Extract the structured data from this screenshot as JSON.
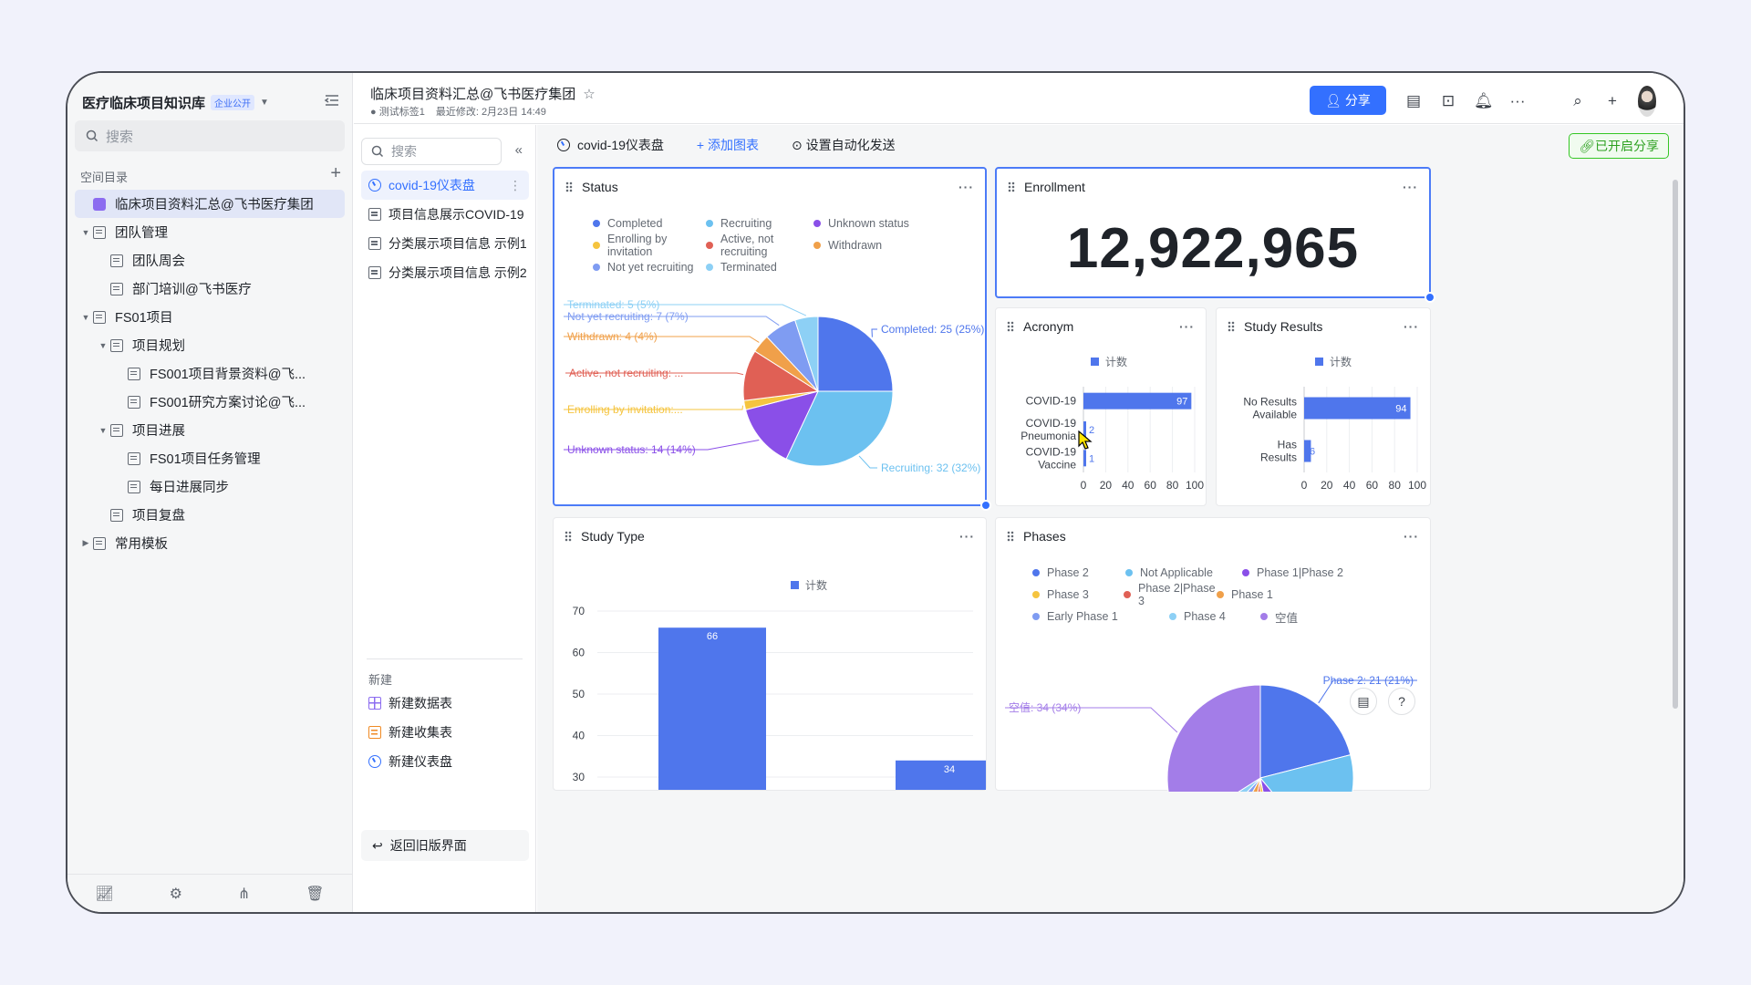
{
  "sidebar": {
    "workspace_title": "医疗临床项目知识库",
    "workspace_badge": "企业公开",
    "search_placeholder": "搜索",
    "section_label": "空间目录",
    "tree": [
      {
        "label": "临床项目资料汇总@飞书医疗集团",
        "level": 0,
        "type": "base",
        "active": true,
        "toggle": ""
      },
      {
        "label": "团队管理",
        "level": 0,
        "type": "doc",
        "toggle": "▼"
      },
      {
        "label": "团队周会",
        "level": 1,
        "type": "doc",
        "toggle": ""
      },
      {
        "label": "部门培训@飞书医疗",
        "level": 1,
        "type": "doc",
        "toggle": ""
      },
      {
        "label": "FS01项目",
        "level": 0,
        "type": "doc",
        "toggle": "▼"
      },
      {
        "label": "项目规划",
        "level": 1,
        "type": "doc",
        "toggle": "▼"
      },
      {
        "label": "FS001项目背景资料@飞...",
        "level": 2,
        "type": "doc",
        "toggle": ""
      },
      {
        "label": "FS001研究方案讨论@飞...",
        "level": 2,
        "type": "doc",
        "toggle": ""
      },
      {
        "label": "项目进展",
        "level": 1,
        "type": "doc",
        "toggle": "▼"
      },
      {
        "label": "FS01项目任务管理",
        "level": 2,
        "type": "doc",
        "toggle": ""
      },
      {
        "label": "每日进展同步",
        "level": 2,
        "type": "doc",
        "toggle": ""
      },
      {
        "label": "项目复盘",
        "level": 1,
        "type": "doc",
        "toggle": ""
      },
      {
        "label": "常用模板",
        "level": 0,
        "type": "doc",
        "toggle": "▶"
      }
    ]
  },
  "header": {
    "doc_title": "临床项目资料汇总@飞书医疗集团",
    "tag": "测试标签1",
    "last_modified": "最近修改: 2月23日 14:49",
    "share_label": "分享"
  },
  "nav2": {
    "search_placeholder": "搜索",
    "items": [
      {
        "label": "covid-19仪表盘",
        "active": true,
        "type": "dash"
      },
      {
        "label": "项目信息展示COVID-19",
        "type": "doc"
      },
      {
        "label": "分类展示项目信息 示例1",
        "type": "doc"
      },
      {
        "label": "分类展示项目信息 示例2",
        "type": "doc"
      }
    ],
    "new_label": "新建",
    "new_items": [
      {
        "label": "新建数据表",
        "type": "sheet"
      },
      {
        "label": "新建收集表",
        "type": "form"
      },
      {
        "label": "新建仪表盘",
        "type": "dash"
      }
    ],
    "back_label": "返回旧版界面"
  },
  "dashboard": {
    "name": "covid-19仪表盘",
    "add_chart": "添加图表",
    "auto_send": "设置自动化发送",
    "shared": "已开启分享",
    "enrollment_title": "Enrollment",
    "enrollment_value": "12,922,965"
  },
  "chart_data": [
    {
      "id": "status",
      "type": "pie",
      "title": "Status",
      "series": [
        {
          "name": "Completed",
          "value": 25,
          "label": "Completed: 25 (25%)",
          "color": "#4f76ec"
        },
        {
          "name": "Recruiting",
          "value": 32,
          "label": "Recruiting: 32 (32%)",
          "color": "#6cc1f0"
        },
        {
          "name": "Unknown status",
          "value": 14,
          "label": "Unknown status: 14 (14%)",
          "color": "#8a4fe8"
        },
        {
          "name": "Enrolling by invitation",
          "value": 2,
          "label": "Enrolling by invitation:...",
          "color": "#f5c43f"
        },
        {
          "name": "Active, not recruiting",
          "value": 11,
          "label": "Active, not recruiting: ...",
          "color": "#e06055"
        },
        {
          "name": "Withdrawn",
          "value": 4,
          "label": "Withdrawn: 4 (4%)",
          "color": "#f0a04a"
        },
        {
          "name": "Not yet recruiting",
          "value": 7,
          "label": "Not yet recruiting: 7 (7%)",
          "color": "#7f9cf2"
        },
        {
          "name": "Terminated",
          "value": 5,
          "label": "Terminated: 5 (5%)",
          "color": "#8dd0f5"
        }
      ]
    },
    {
      "id": "acronym",
      "type": "bar",
      "orientation": "horizontal",
      "title": "Acronym",
      "legend": "计数",
      "categories": [
        "COVID-19",
        "COVID-19 Pneumonia",
        "COVID-19 Vaccine"
      ],
      "values": [
        97,
        2,
        1
      ],
      "xlim": [
        0,
        100
      ],
      "ticks": [
        0,
        20,
        40,
        60,
        80,
        100
      ],
      "color": "#4f76ec"
    },
    {
      "id": "study_results",
      "type": "bar",
      "orientation": "horizontal",
      "title": "Study Results",
      "legend": "计数",
      "categories": [
        "No Results Available",
        "Has Results"
      ],
      "values": [
        94,
        6
      ],
      "xlim": [
        0,
        100
      ],
      "ticks": [
        0,
        20,
        40,
        60,
        80,
        100
      ],
      "color": "#4f76ec"
    },
    {
      "id": "study_type",
      "type": "bar",
      "orientation": "vertical",
      "title": "Study Type",
      "legend": "计数",
      "values": [
        66,
        34
      ],
      "ylim": [
        20,
        70
      ],
      "ticks": [
        20,
        30,
        40,
        50,
        60,
        70
      ],
      "color": "#4f76ec"
    },
    {
      "id": "phases",
      "type": "pie",
      "title": "Phases",
      "series": [
        {
          "name": "Phase 2",
          "value": 21,
          "label": "Phase 2: 21 (21%)",
          "color": "#4f76ec"
        },
        {
          "name": "Not Applicable",
          "value": 18,
          "color": "#6cc1f0"
        },
        {
          "name": "Phase 1|Phase 2",
          "value": 8,
          "color": "#8a4fe8"
        },
        {
          "name": "Phase 3",
          "value": 3,
          "color": "#f5c43f"
        },
        {
          "name": "Phase 2|Phase 3",
          "value": 3,
          "color": "#e06055"
        },
        {
          "name": "Phase 1",
          "value": 5,
          "color": "#f0a04a"
        },
        {
          "name": "Early Phase 1",
          "value": 4,
          "color": "#7f9cf2"
        },
        {
          "name": "Phase 4",
          "value": 4,
          "color": "#8dd0f5"
        },
        {
          "name": "空值",
          "value": 34,
          "label": "空值: 34 (34%)",
          "color": "#a37de8"
        }
      ]
    }
  ]
}
